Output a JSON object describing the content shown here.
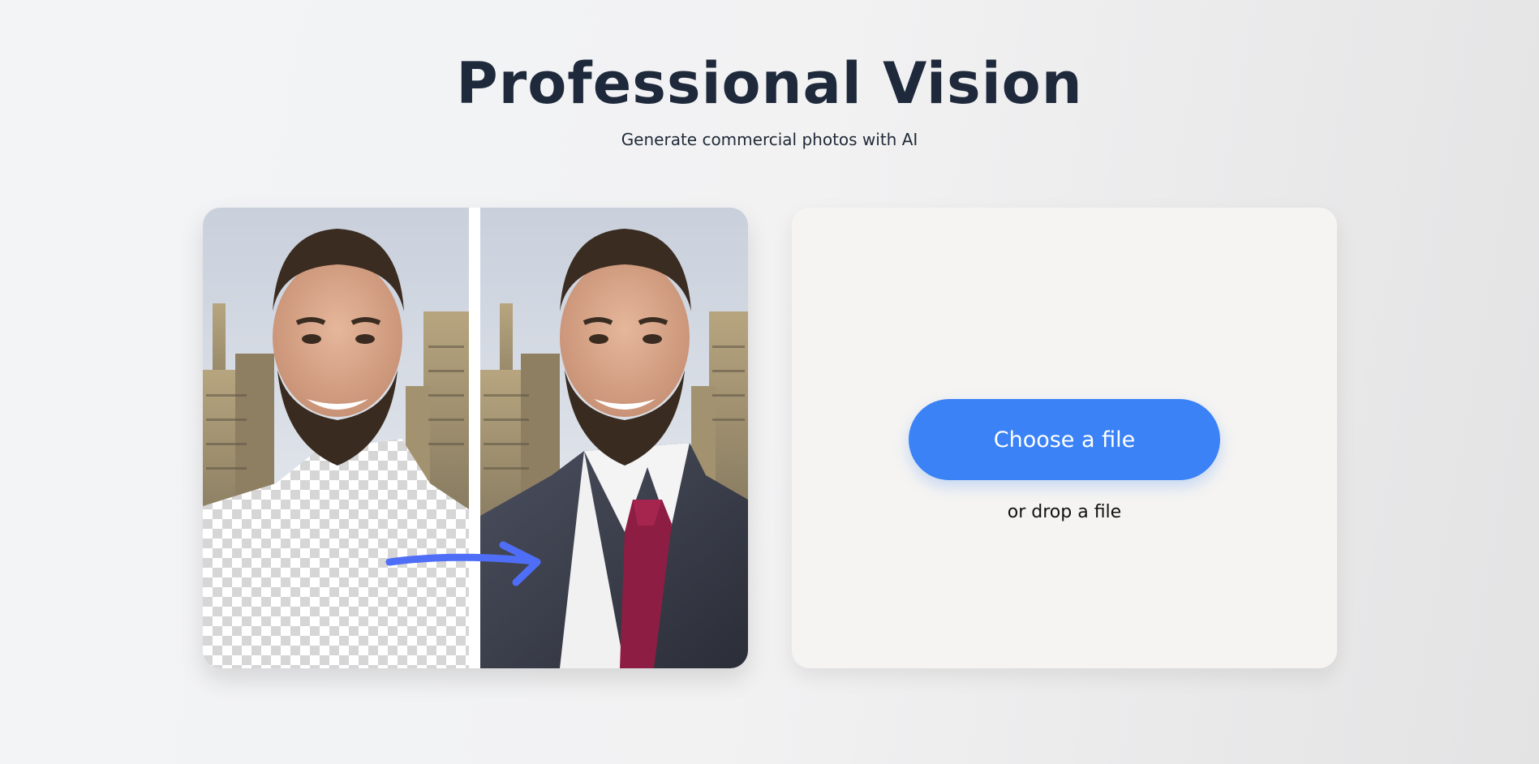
{
  "header": {
    "title": "Professional Vision",
    "subtitle": "Generate commercial photos with AI"
  },
  "demo": {
    "before_image": "portrait-transparent-body",
    "after_image": "portrait-business-suit",
    "arrow_icon": "arrow-right-icon",
    "accent_color": "#4f6ef7"
  },
  "upload": {
    "button_label": "Choose a file",
    "hint": "or drop a file",
    "button_color": "#3b82f6"
  }
}
